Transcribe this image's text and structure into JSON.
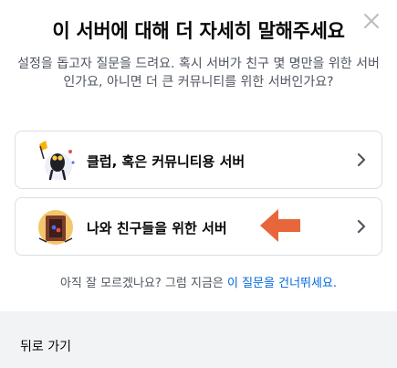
{
  "modal": {
    "title": "이 서버에 대해 더 자세히 말해주세요",
    "subtitle": "설정을 돕고자 질문을 드려요. 혹시 서버가 친구 몇 명만을 위한 서버인가요, 아니면 더 큰 커뮤니티를 위한 서버인가요?",
    "close_icon": "close-icon"
  },
  "options": [
    {
      "label": "클럽, 혹은 커뮤니티용 서버",
      "icon": "club-community-illustration"
    },
    {
      "label": "나와 친구들을 위한 서버",
      "icon": "friends-illustration"
    }
  ],
  "skip": {
    "prefix": "아직 잘 모르겠나요? 그럼 지금은 ",
    "link": "이 질문을 건너뛰세요."
  },
  "footer": {
    "back_label": "뒤로 가기"
  },
  "colors": {
    "title": "#060607",
    "subtitle": "#4f5660",
    "link": "#0068e0",
    "option_border": "#dcdee1",
    "footer_bg": "#f2f3f5",
    "annotation_arrow": "#e8663c"
  }
}
